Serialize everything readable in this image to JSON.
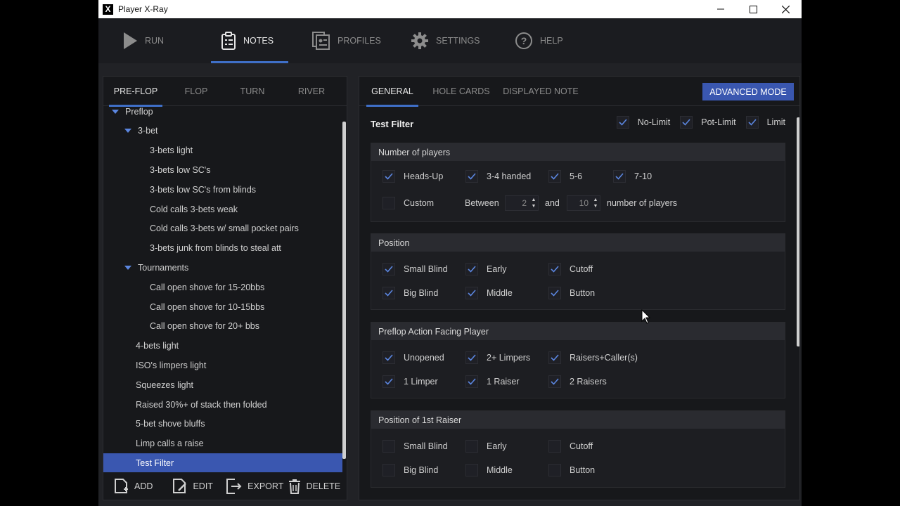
{
  "window": {
    "title": "Player X-Ray",
    "logo": "X"
  },
  "nav": [
    {
      "label": "RUN",
      "icon": "play-icon",
      "active": false
    },
    {
      "label": "NOTES",
      "icon": "clipboard-icon",
      "active": true
    },
    {
      "label": "PROFILES",
      "icon": "profiles-icon",
      "active": false
    },
    {
      "label": "SETTINGS",
      "icon": "gear-icon",
      "active": false
    },
    {
      "label": "HELP",
      "icon": "help-icon",
      "active": false
    }
  ],
  "left": {
    "tabs": [
      "PRE-FLOP",
      "FLOP",
      "TURN",
      "RIVER"
    ],
    "active_tab": 0,
    "tree": [
      {
        "label": "Preflop",
        "level": 0,
        "expandable": true
      },
      {
        "label": "3-bet",
        "level": 1,
        "expandable": true
      },
      {
        "label": "3-bets light",
        "level": 2
      },
      {
        "label": "3-bets low SC's",
        "level": 2
      },
      {
        "label": "3-bets low SC's from blinds",
        "level": 2
      },
      {
        "label": "Cold calls 3-bets weak",
        "level": 2
      },
      {
        "label": "Cold calls 3-bets w/ small pocket pairs",
        "level": 2
      },
      {
        "label": "3-bets junk from blinds to steal att",
        "level": 2
      },
      {
        "label": "Tournaments",
        "level": 1,
        "expandable": true
      },
      {
        "label": "Call open shove for 15-20bbs",
        "level": 2
      },
      {
        "label": "Call open shove for 10-15bbs",
        "level": 2
      },
      {
        "label": "Call open shove for 20+ bbs",
        "level": 2
      },
      {
        "label": "4-bets light",
        "level": 1
      },
      {
        "label": "ISO's limpers light",
        "level": 1
      },
      {
        "label": "Squeezes light",
        "level": 1
      },
      {
        "label": "Raised 30%+ of stack then folded",
        "level": 1
      },
      {
        "label": "5-bet shove bluffs",
        "level": 1
      },
      {
        "label": "Limp calls a raise",
        "level": 1
      },
      {
        "label": "Test Filter",
        "level": 1,
        "selected": true
      }
    ],
    "actions": [
      "ADD",
      "EDIT",
      "EXPORT",
      "DELETE"
    ]
  },
  "right": {
    "tabs": [
      "GENERAL",
      "HOLE CARDS",
      "DISPLAYED NOTE"
    ],
    "active_tab": 0,
    "advanced_button": "ADVANCED MODE",
    "filter_name": "Test Filter",
    "limits": [
      {
        "label": "No-Limit",
        "checked": true
      },
      {
        "label": "Pot-Limit",
        "checked": true
      },
      {
        "label": "Limit",
        "checked": true
      }
    ],
    "players": {
      "header": "Number of players",
      "options": [
        {
          "label": "Heads-Up",
          "checked": true
        },
        {
          "label": "3-4 handed",
          "checked": true
        },
        {
          "label": "5-6",
          "checked": true
        },
        {
          "label": "7-10",
          "checked": true
        }
      ],
      "custom": {
        "label": "Custom",
        "checked": false
      },
      "between": "Between",
      "min": "2",
      "and": "and",
      "max": "10",
      "suffix": "number of players"
    },
    "position": {
      "header": "Position",
      "options": [
        {
          "label": "Small Blind",
          "checked": true
        },
        {
          "label": "Early",
          "checked": true
        },
        {
          "label": "Cutoff",
          "checked": true
        },
        {
          "label": "Big Blind",
          "checked": true
        },
        {
          "label": "Middle",
          "checked": true
        },
        {
          "label": "Button",
          "checked": true
        }
      ]
    },
    "action_facing": {
      "header": "Preflop Action Facing Player",
      "options": [
        {
          "label": "Unopened",
          "checked": true
        },
        {
          "label": "2+ Limpers",
          "checked": true
        },
        {
          "label": "Raisers+Caller(s)",
          "checked": true
        },
        {
          "label": "1 Limper",
          "checked": true
        },
        {
          "label": "1 Raiser",
          "checked": true
        },
        {
          "label": "2 Raisers",
          "checked": true
        }
      ]
    },
    "first_raiser": {
      "header": "Position of 1st Raiser",
      "options": [
        {
          "label": "Small Blind",
          "checked": false
        },
        {
          "label": "Early",
          "checked": false
        },
        {
          "label": "Cutoff",
          "checked": false
        },
        {
          "label": "Big Blind",
          "checked": false
        },
        {
          "label": "Middle",
          "checked": false
        },
        {
          "label": "Button",
          "checked": false
        }
      ]
    }
  },
  "colors": {
    "accent": "#3a57b0",
    "check": "#5b86e0"
  }
}
